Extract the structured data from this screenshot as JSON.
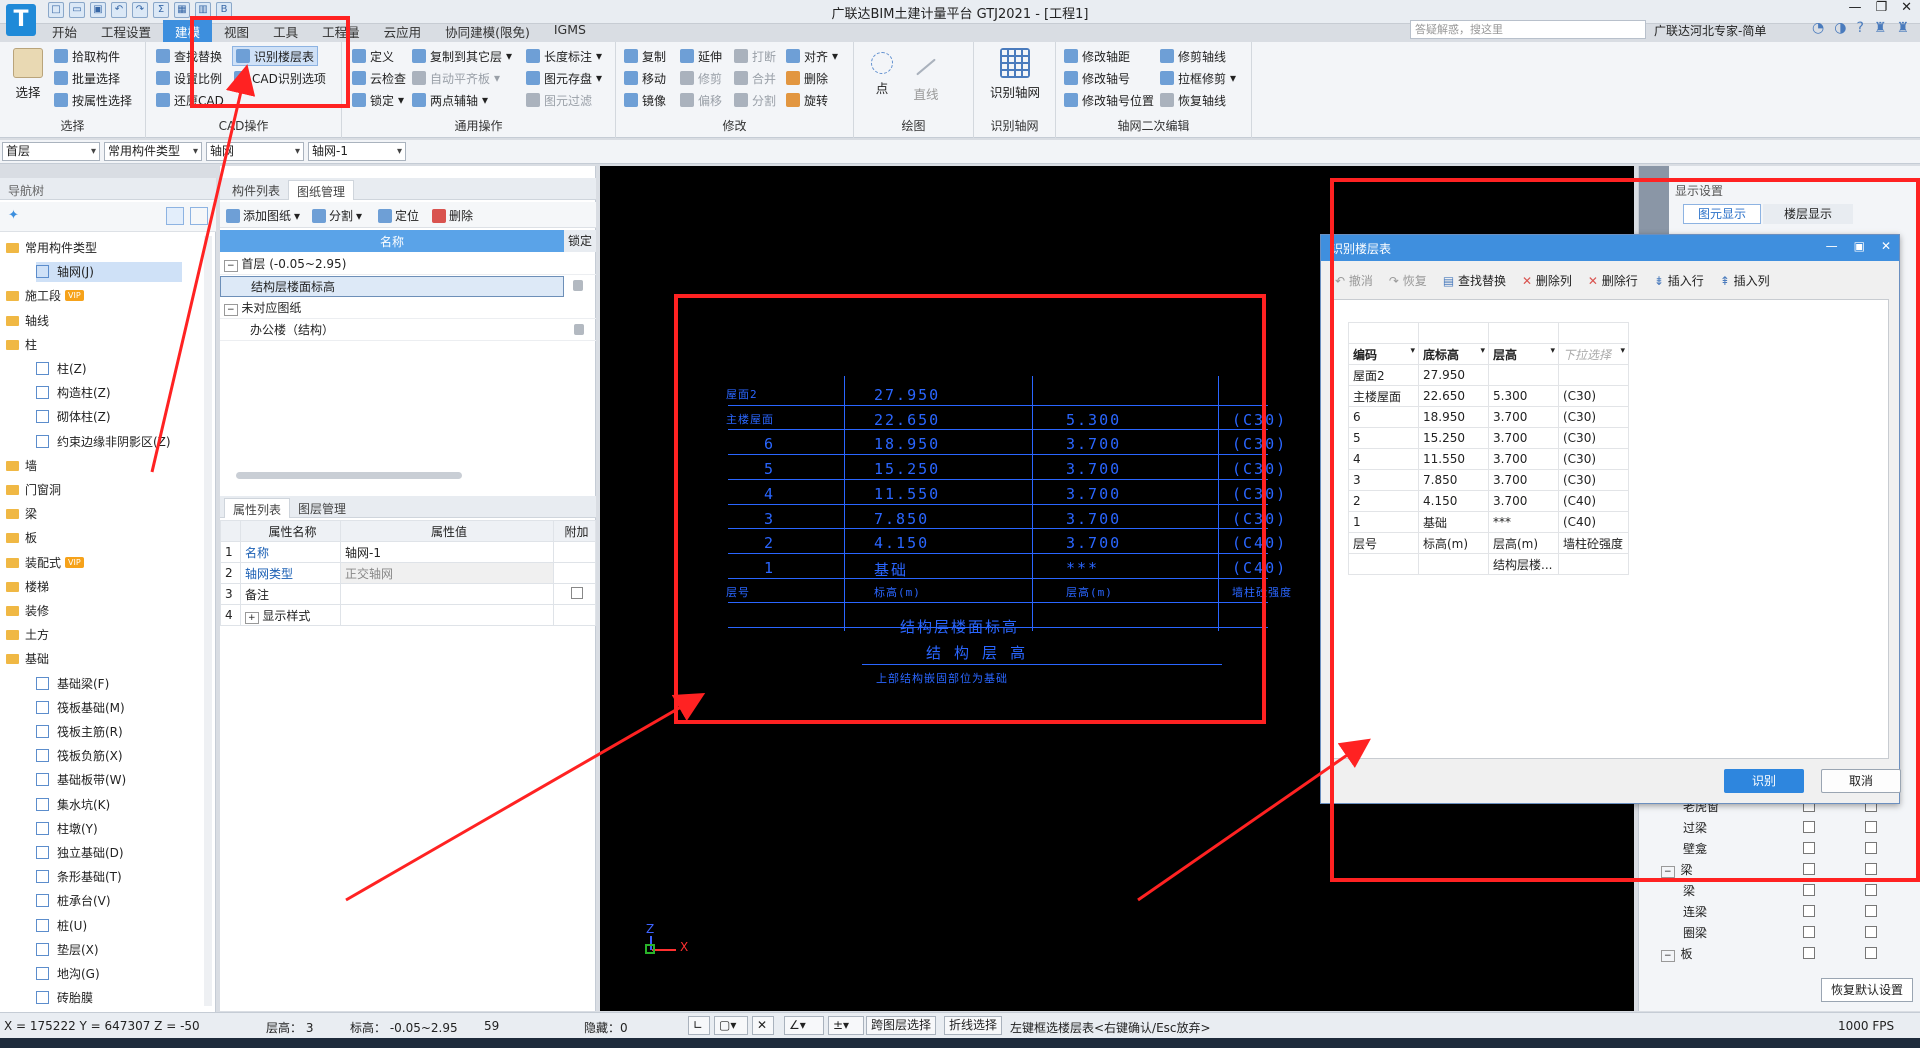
{
  "app": {
    "title": "广联达BIM土建计量平台 GTJ2021 - [工程1]",
    "logo": "T",
    "search_placeholder": "答疑解惑，搜这里",
    "expert": "广联达河北专家-简单"
  },
  "menu_tabs": [
    "开始",
    "工程设置",
    "建模",
    "视图",
    "工具",
    "工程量",
    "云应用",
    "协同建模(限免)",
    "IGMS"
  ],
  "ribbon": {
    "select": {
      "big": "选择",
      "items": [
        "拾取构件",
        "批量选择",
        "按属性选择"
      ],
      "title": "选择"
    },
    "cad": {
      "items": [
        "查找替换",
        "识别楼层表",
        "设置比例",
        "CAD识别选项",
        "还原CAD"
      ],
      "title": "CAD操作"
    },
    "general": {
      "items": [
        "定义",
        "复制到其它层",
        "长度标注",
        "云检查",
        "自动平齐板",
        "图元存盘",
        "锁定",
        "两点辅轴",
        "图元过滤"
      ],
      "title": "通用操作"
    },
    "modify": {
      "items": [
        "复制",
        "延伸",
        "打断",
        "对齐",
        "移动",
        "修剪",
        "合并",
        "删除",
        "镜像",
        "偏移",
        "分割",
        "旋转"
      ],
      "title": "修改"
    },
    "draw": {
      "items": [
        "点",
        "直线"
      ],
      "title": "绘图"
    },
    "identify": {
      "big": "识别轴网",
      "title": "识别轴网"
    },
    "axis_edit": {
      "items": [
        "修改轴距",
        "修剪轴线",
        "修改轴号",
        "拉框修剪",
        "修改轴号位置",
        "恢复轴线"
      ],
      "title": "轴网二次编辑"
    }
  },
  "selectors": [
    "首层",
    "常用构件类型",
    "轴网",
    "轴网-1"
  ],
  "nav": {
    "title": "导航树",
    "items": [
      {
        "label": "常用构件类型",
        "type": "folder"
      },
      {
        "label": "轴网(J)",
        "type": "child",
        "selected": true
      },
      {
        "label": "施工段",
        "type": "folder",
        "vip": true
      },
      {
        "label": "轴线",
        "type": "folder"
      },
      {
        "label": "柱",
        "type": "folder"
      },
      {
        "label": "柱(Z)",
        "type": "child"
      },
      {
        "label": "构造柱(Z)",
        "type": "child"
      },
      {
        "label": "砌体柱(Z)",
        "type": "child"
      },
      {
        "label": "约束边缘非阴影区(Z)",
        "type": "child"
      },
      {
        "label": "墙",
        "type": "folder"
      },
      {
        "label": "门窗洞",
        "type": "folder"
      },
      {
        "label": "梁",
        "type": "folder"
      },
      {
        "label": "板",
        "type": "folder"
      },
      {
        "label": "装配式",
        "type": "folder",
        "vip": true
      },
      {
        "label": "楼梯",
        "type": "folder"
      },
      {
        "label": "装修",
        "type": "folder"
      },
      {
        "label": "土方",
        "type": "folder"
      },
      {
        "label": "基础",
        "type": "folder"
      },
      {
        "label": "基础梁(F)",
        "type": "child"
      },
      {
        "label": "筏板基础(M)",
        "type": "child"
      },
      {
        "label": "筏板主筋(R)",
        "type": "child"
      },
      {
        "label": "筏板负筋(X)",
        "type": "child"
      },
      {
        "label": "基础板带(W)",
        "type": "child"
      },
      {
        "label": "集水坑(K)",
        "type": "child"
      },
      {
        "label": "柱墩(Y)",
        "type": "child"
      },
      {
        "label": "独立基础(D)",
        "type": "child"
      },
      {
        "label": "条形基础(T)",
        "type": "child"
      },
      {
        "label": "桩承台(V)",
        "type": "child"
      },
      {
        "label": "桩(U)",
        "type": "child"
      },
      {
        "label": "垫层(X)",
        "type": "child"
      },
      {
        "label": "地沟(G)",
        "type": "child"
      },
      {
        "label": "砖胎膜",
        "type": "child"
      }
    ],
    "vip_label": "VIP"
  },
  "drawings": {
    "tabs": [
      "构件列表",
      "图纸管理"
    ],
    "tools": [
      "添加图纸",
      "分割",
      "定位",
      "删除"
    ],
    "col_name": "名称",
    "col_lock": "锁定",
    "rows": [
      "首层 (-0.05~2.95)",
      "结构层楼面标高",
      "未对应图纸",
      "办公楼（结构）"
    ]
  },
  "props": {
    "tabs": [
      "属性列表",
      "图层管理"
    ],
    "headers": [
      "属性名称",
      "属性值",
      "附加"
    ],
    "rows": [
      {
        "n": "1",
        "name": "名称",
        "value": "轴网-1"
      },
      {
        "n": "2",
        "name": "轴网类型",
        "value": "正交轴网"
      },
      {
        "n": "3",
        "name": "备注",
        "value": ""
      },
      {
        "n": "4",
        "name": "显示样式",
        "value": ""
      }
    ]
  },
  "cad": {
    "rows": [
      [
        "屋面2",
        "27.950",
        "",
        ""
      ],
      [
        "主楼屋面",
        "22.650",
        "5.300",
        "(C30)"
      ],
      [
        "6",
        "18.950",
        "3.700",
        "(C30)"
      ],
      [
        "5",
        "15.250",
        "3.700",
        "(C30)"
      ],
      [
        "4",
        "11.550",
        "3.700",
        "(C30)"
      ],
      [
        "3",
        "7.850",
        "3.700",
        "(C30)"
      ],
      [
        "2",
        "4.150",
        "3.700",
        "(C40)"
      ],
      [
        "1",
        "基础",
        "***",
        "(C40)"
      ]
    ],
    "footer": [
      "层号",
      "标高(m)",
      "层高(m)",
      "墙柱砼强度"
    ],
    "caption1": "结构层楼面标高",
    "caption2": "结 构 层 高",
    "note": "上部结构嵌固部位为基础"
  },
  "display_settings": {
    "title": "显示设置",
    "tabs": [
      "图元显示",
      "楼层显示"
    ],
    "items": [
      "老虎窗",
      "过梁",
      "壁龛",
      "梁",
      "梁",
      "连梁",
      "圈梁",
      "板"
    ],
    "restore": "恢复默认设置"
  },
  "dialog": {
    "title": "识别楼层表",
    "tools": [
      "撤消",
      "恢复",
      "查找替换",
      "删除列",
      "删除行",
      "插入行",
      "插入列"
    ],
    "headers": [
      "编码",
      "底标高",
      "层高",
      "下拉选择"
    ],
    "rows": [
      [
        "屋面2",
        "27.950",
        "",
        ""
      ],
      [
        "主楼屋面",
        "22.650",
        "5.300",
        "(C30)"
      ],
      [
        "6",
        "18.950",
        "3.700",
        "(C30)"
      ],
      [
        "5",
        "15.250",
        "3.700",
        "(C30)"
      ],
      [
        "4",
        "11.550",
        "3.700",
        "(C30)"
      ],
      [
        "3",
        "7.850",
        "3.700",
        "(C30)"
      ],
      [
        "2",
        "4.150",
        "3.700",
        "(C40)"
      ],
      [
        "1",
        "基础",
        "***",
        "(C40)"
      ],
      [
        "层号",
        "标高(m)",
        "层高(m)",
        "墙柱砼强度"
      ],
      [
        "",
        "",
        "结构层楼...",
        ""
      ]
    ],
    "ok": "识别",
    "cancel": "取消"
  },
  "status": {
    "coords": "X = 175222 Y = 647307 Z = -50",
    "floor_h": "层高： 3",
    "elev": "标高： -0.05~2.95",
    "num": "59",
    "hidden": "隐藏：0",
    "btn1": "跨图层选择",
    "btn2": "折线选择",
    "hint": "左键框选楼层表<右键确认/Esc放弃>",
    "fps": "1000 FPS"
  },
  "colors": {
    "accent": "#3d8fde",
    "cad_blue": "#2a66ff",
    "annotation": "#ff2222"
  }
}
